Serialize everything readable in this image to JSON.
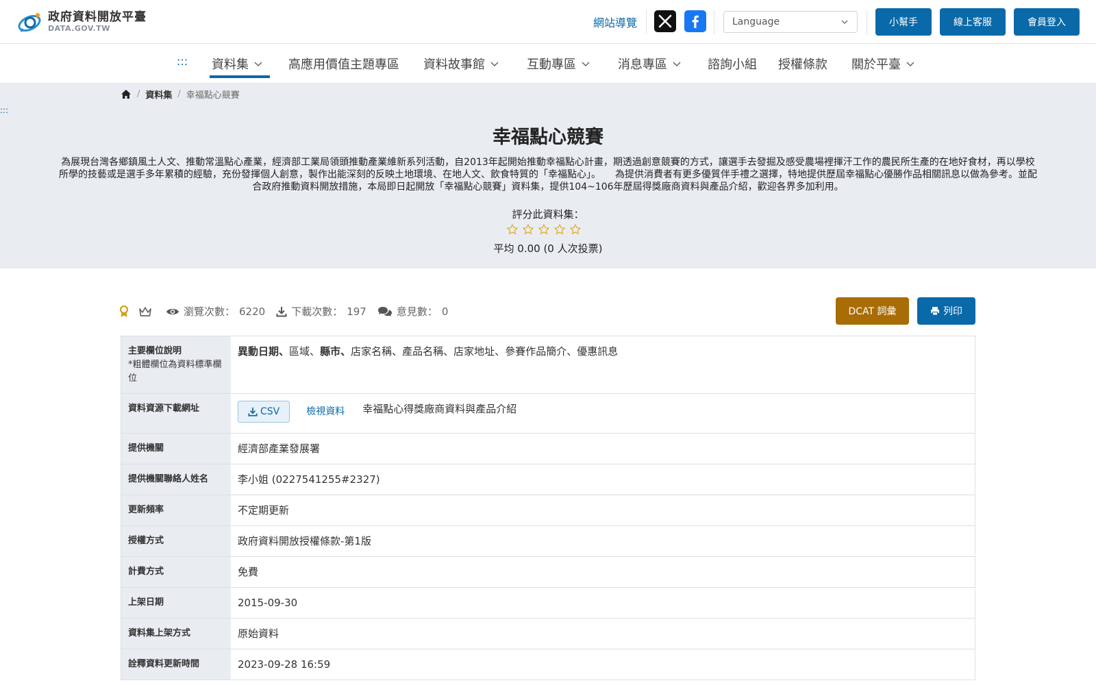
{
  "header": {
    "logo_title": "政府資料開放平臺",
    "logo_sub": "DATA.GOV.TW",
    "sitemap": "網站導覽",
    "language_placeholder": "Language",
    "helper_button": "小幫手",
    "service_button": "線上客服",
    "login_button": "會員登入"
  },
  "nav": {
    "accessibility_marker": ":::",
    "items": [
      "資料集",
      "高應用價值主題專區",
      "資料故事館",
      "互動專區",
      "消息專區",
      "諮詢小組",
      "授權條款",
      "關於平臺"
    ]
  },
  "breadcrumb": {
    "level1": "資料集",
    "current": "幸福點心競賽"
  },
  "hero": {
    "side_marker": ":::",
    "title": "幸福點心競賽",
    "description": "為展現台灣各鄉鎮風土人文、推動常溫點心產業，經濟部工業局領頭推動產業維新系列活動，自2013年起開始推動幸福點心計畫，期透過創意競賽的方式，讓選手去發掘及感受農場裡揮汗工作的農民所生產的在地好食材，再以學校所學的技藝或是選手多年累積的經驗，充份發揮個人創意，製作出能深刻的反映土地環境、在地人文、飲食特質的「幸福點心」。　　為提供消費者有更多優質伴手禮之選擇，特地提供歷屆幸福點心優勝作品相關訊息以做為參考。並配合政府推動資料開放措施，本局即日起開放「幸福點心競賽」資料集，提供104~106年歷屆得獎廠商資料與產品介紹，歡迎各界多加利用。",
    "rate_label": "評分此資料集：",
    "rating_value": 0,
    "rating_max": 5,
    "average": "平均 0.00 (0 人次投票)"
  },
  "stats": {
    "views_label": "瀏覽次數：",
    "views": "6220",
    "downloads_label": "下載次數：",
    "downloads": "197",
    "comments_label": "意見數：",
    "comments": "0",
    "dcat_button": "DCAT 詞彙",
    "print_button": "列印"
  },
  "table": {
    "fields": {
      "label": "主要欄位說明",
      "note": "*粗體欄位為資料標準欄位",
      "items": [
        {
          "text": "異動日期",
          "bold": true
        },
        {
          "text": "區域",
          "bold": false
        },
        {
          "text": "縣市",
          "bold": true
        },
        {
          "text": "店家名稱",
          "bold": false
        },
        {
          "text": "產品名稱",
          "bold": false
        },
        {
          "text": "店家地址",
          "bold": false
        },
        {
          "text": "參賽作品簡介",
          "bold": false
        },
        {
          "text": "優惠訊息",
          "bold": false
        }
      ]
    },
    "resource": {
      "label": "資料資源下載網址",
      "format": "CSV",
      "view_link": "檢視資料",
      "name": "幸福點心得獎廠商資料與產品介紹"
    },
    "rows": [
      {
        "label": "提供機關",
        "value": "經濟部產業發展署",
        "link": true
      },
      {
        "label": "提供機關聯絡人姓名",
        "value": "李小姐 (0227541255#2327)",
        "link": false
      },
      {
        "label": "更新頻率",
        "value": "不定期更新",
        "link": false
      },
      {
        "label": "授權方式",
        "value": "政府資料開放授權條款-第1版",
        "link": false
      },
      {
        "label": "計費方式",
        "value": "免費",
        "link": false
      },
      {
        "label": "上架日期",
        "value": "2015-09-30",
        "link": false
      },
      {
        "label": "資料集上架方式",
        "value": "原始資料",
        "link": false
      },
      {
        "label": "詮釋資料更新時間",
        "value": "2023-09-28 16:59",
        "link": false
      }
    ]
  },
  "colors": {
    "primary": "#0a69a8",
    "dcat": "#a86d06",
    "hero_bg": "#e9edf1",
    "star": "#e6a817"
  }
}
